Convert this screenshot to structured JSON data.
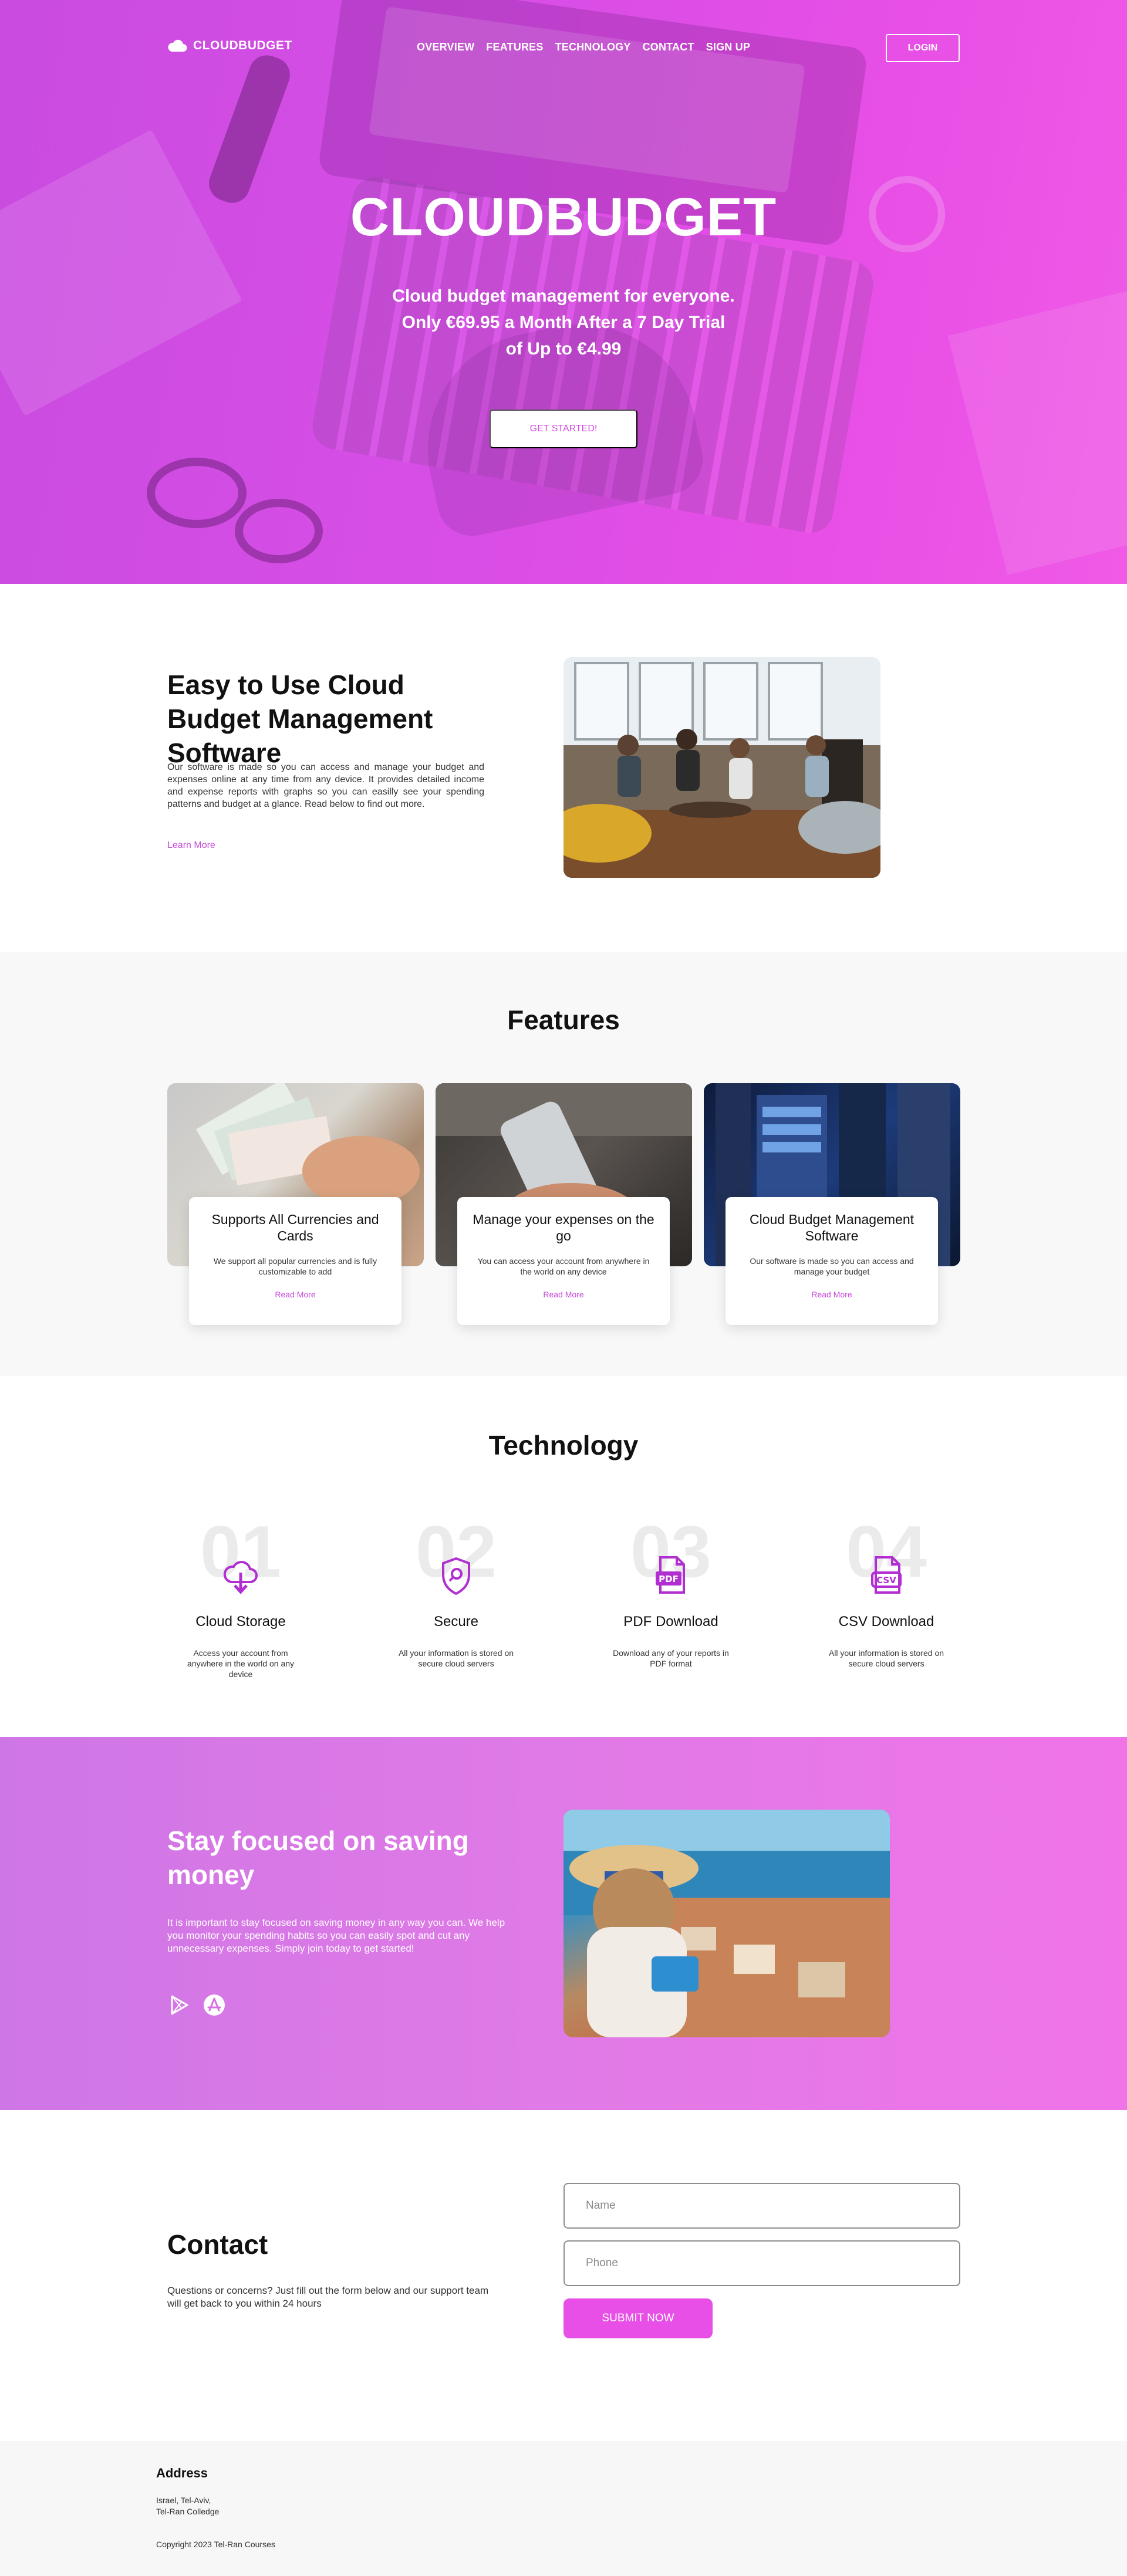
{
  "nav": {
    "logo": "CLOUDBUDGET",
    "items": [
      "OVERVIEW",
      "FEATURES",
      "TECHNOLOGY",
      "CONTACT",
      "SIGN UP"
    ],
    "login": "LOGIN"
  },
  "hero": {
    "title": "CLOUDBUDGET",
    "subtitle_lines": [
      "Cloud budget management for everyone.",
      "Only €69.95 a Month After a 7 Day Trial",
      "of Up to €4.99"
    ],
    "button": "GET STARTED!"
  },
  "about": {
    "title": "Easy to Use Cloud Budget Management Software",
    "text": "Our software is made so you can access and manage your budget and expenses online at any time from any device. It provides detailed income and expense reports with graphs so you can easilly see your spending patterns and budget at a glance. Read below to find out more.",
    "link": "Learn More"
  },
  "features": {
    "title": "Features",
    "cards": [
      {
        "title": "Supports All Currencies and Cards",
        "text": "We support all popular currencies and is fully customizable to add",
        "link": "Read More"
      },
      {
        "title": "Manage your expenses on the go",
        "text": "You can access your account from anywhere in the world on any device",
        "link": "Read More"
      },
      {
        "title": "Cloud Budget Management Software",
        "text": "Our software is made so you can access and manage your budget",
        "link": "Read More"
      }
    ]
  },
  "technology": {
    "title": "Technology",
    "items": [
      {
        "number": "01",
        "title": "Cloud Storage",
        "text": "Access your account from anywhere in the world on any device",
        "icon": "cloud-download-icon"
      },
      {
        "number": "02",
        "title": "Secure",
        "text": "All your information is stored on secure cloud servers",
        "icon": "shield-search-icon"
      },
      {
        "number": "03",
        "title": "PDF Download",
        "text": "Download any of your reports in PDF format",
        "icon": "pdf-file-icon"
      },
      {
        "number": "04",
        "title": "CSV Download",
        "text": "All your information is stored on secure cloud servers",
        "icon": "csv-file-icon"
      }
    ]
  },
  "saving": {
    "title": "Stay focused on saving money",
    "text": "It is important to stay focused on saving money in any way you can. We help you monitor your spending habits so you can easily spot and cut any unnecessary expenses. Simply join today to get started!",
    "icons": [
      "google-play-icon",
      "app-store-icon"
    ]
  },
  "contact": {
    "title": "Contact",
    "text": "Questions or concerns? Just fill out the form below and our support team will get back to you within 24 hours",
    "name_placeholder": "Name",
    "phone_placeholder": "Phone",
    "submit": "SUBMIT NOW"
  },
  "footer": {
    "heading": "Address",
    "address_lines": [
      "Israel, Tel-Aviv,",
      "Tel-Ran Colledge"
    ],
    "copyright": "Copyright 2023 Tel-Ran Courses"
  },
  "colors": {
    "accent": "#d24be0",
    "button": "#e74fe6",
    "link": "#c54ad9"
  }
}
